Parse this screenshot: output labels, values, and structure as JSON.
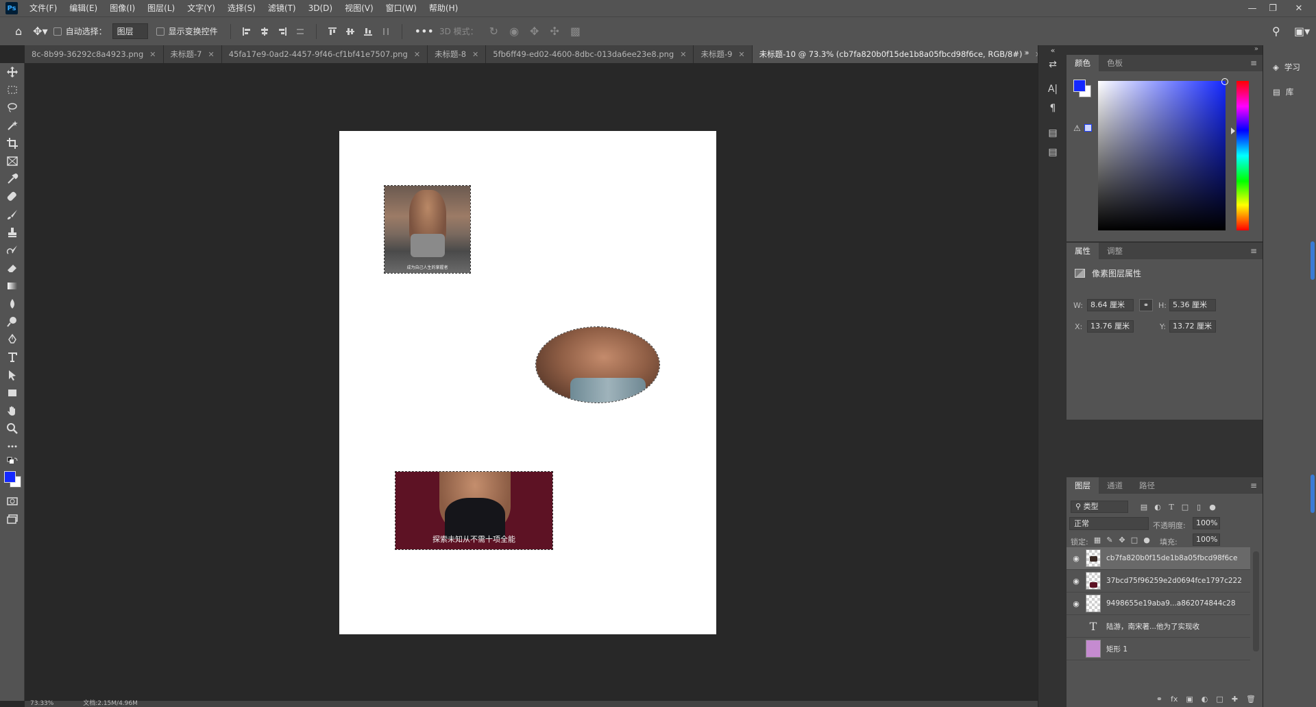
{
  "app": {
    "logo": "Ps"
  },
  "menu": [
    "文件(F)",
    "编辑(E)",
    "图像(I)",
    "图层(L)",
    "文字(Y)",
    "选择(S)",
    "滤镜(T)",
    "3D(D)",
    "视图(V)",
    "窗口(W)",
    "帮助(H)"
  ],
  "options": {
    "auto_select_label": "自动选择：",
    "auto_select_value": "图层",
    "show_transform_label": "显示变换控件",
    "mode3d_label": "3D 模式："
  },
  "tabs": [
    {
      "label": "8c-8b99-36292c8a4923.png",
      "active": false
    },
    {
      "label": "未标题-7",
      "active": false
    },
    {
      "label": "45fa17e9-0ad2-4457-9f46-cf1bf41e7507.png",
      "active": false
    },
    {
      "label": "未标题-8",
      "active": false
    },
    {
      "label": "5fb6ff49-ed02-4600-8dbc-013da6ee23e8.png",
      "active": false
    },
    {
      "label": "未标题-9",
      "active": false
    },
    {
      "label": "未标题-10 @ 73.3% (cb7fa820b0f15de1b8a05fbcd98f6ce, RGB/8#) *",
      "active": true
    }
  ],
  "canvas": {
    "caption1": "成为自己人生的掌握者",
    "caption3": "探索未知从不需十项全能"
  },
  "status": {
    "zoom": "73.33%",
    "doc": "文档:2.15M/4.96M"
  },
  "color_panel": {
    "tabs": [
      "颜色",
      "色板"
    ],
    "fg": "#1428ff",
    "bg": "#ffffff"
  },
  "props_panel": {
    "tabs": [
      "属性",
      "调整"
    ],
    "title": "像素图层属性",
    "w_label": "W:",
    "w_value": "8.64 厘米",
    "h_label": "H:",
    "h_value": "5.36 厘米",
    "x_label": "X:",
    "x_value": "13.76 厘米",
    "y_label": "Y:",
    "y_value": "13.72 厘米"
  },
  "layers_panel": {
    "tabs": [
      "图层",
      "通道",
      "路径"
    ],
    "filter": "类型",
    "blend": "正常",
    "opacity_label": "不透明度:",
    "opacity": "100%",
    "lock_label": "锁定:",
    "fill_label": "填充:",
    "fill": "100%",
    "layers": [
      {
        "name": "cb7fa820b0f15de1b8a05fbcd98f6ce",
        "visible": true,
        "active": true
      },
      {
        "name": "37bcd75f96259e2d0694fce1797c222",
        "visible": true,
        "active": false
      },
      {
        "name": "9498655e19aba9...a862074844c28",
        "visible": true,
        "active": false
      },
      {
        "name": "陆游，南宋著...他为了实现收",
        "visible": false,
        "active": false,
        "type": "text"
      },
      {
        "name": "矩形 1",
        "visible": false,
        "active": false,
        "type": "shape"
      }
    ]
  },
  "right_buttons": [
    {
      "label": "学习",
      "icon": "lightbulb-icon"
    },
    {
      "label": "库",
      "icon": "library-icon"
    }
  ]
}
